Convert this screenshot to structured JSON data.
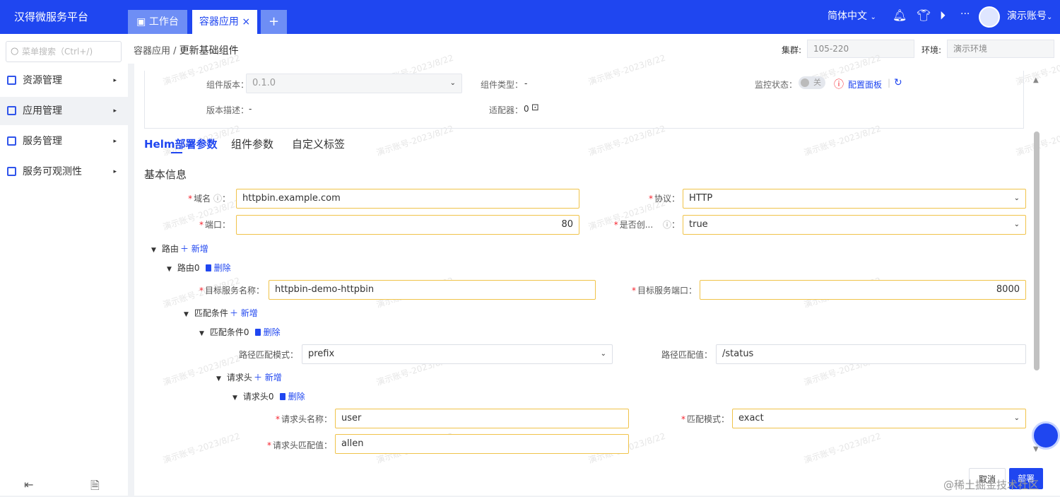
{
  "header": {
    "brand": "汉得微服务平台",
    "tabs": [
      {
        "label": "工作台",
        "icon": "monitor-icon"
      },
      {
        "label": "容器应用",
        "close": "×"
      },
      {
        "label": "+"
      }
    ],
    "language": "简体中文",
    "more": "···",
    "user": "演示账号"
  },
  "sidebar": {
    "search_placeholder": "菜单搜索（Ctrl+/)",
    "items": [
      {
        "label": "资源管理",
        "icon": "cube-icon"
      },
      {
        "label": "应用管理",
        "icon": "cube-icon",
        "active": true
      },
      {
        "label": "服务管理",
        "icon": "service-icon"
      },
      {
        "label": "服务可观测性",
        "icon": "service-icon"
      }
    ]
  },
  "breadcrumb": {
    "parent": "容器应用",
    "sep": "/",
    "current": "更新基础组件",
    "cluster_label": "集群:",
    "cluster_value": "105-220",
    "env_label": "环境:",
    "env_value": "演示环境"
  },
  "info": {
    "version_label": "组件版本：",
    "version_value": "0.1.0",
    "type_label": "组件类型：",
    "type_value": "-",
    "monitor_label": "监控状态：",
    "monitor_toggle": "关",
    "config_panel": "配置面板",
    "desc_label": "版本描述：",
    "desc_value": "-",
    "adapter_label": "适配器：",
    "adapter_value": "0"
  },
  "tabs": [
    "Helm部署参数",
    "组件参数",
    "自定义标签"
  ],
  "section_title": "基本信息",
  "form": {
    "domain_label": "域名",
    "domain_value": "httpbin.example.com",
    "protocol_label": "协议：",
    "protocol_value": "HTTP",
    "port_label": "端口：",
    "port_value": "80",
    "create_label": "是否创...",
    "create_value": "true",
    "routes_label": "路由",
    "add_label": "新增",
    "delete_label": "删除",
    "route0_label": "路由0",
    "target_name_label": "目标服务名称：",
    "target_name_value": "httpbin-demo-httpbin",
    "target_port_label": "目标服务端口：",
    "target_port_value": "8000",
    "match_label": "匹配条件",
    "match0_label": "匹配条件0",
    "path_mode_label": "路径匹配模式：",
    "path_mode_value": "prefix",
    "path_value_label": "路径匹配值：",
    "path_value": "/status",
    "headers_label": "请求头",
    "header0_label": "请求头0",
    "header_name_label": "请求头名称：",
    "header_name_value": "user",
    "match_mode_label": "匹配模式：",
    "match_mode_value": "exact",
    "header_value_label": "请求头匹配值：",
    "header_value": "allen"
  },
  "buttons": {
    "cancel": "取消",
    "deploy": "部署"
  },
  "watermark": "演示账号-2023/8/22",
  "footer_watermark": "@稀土掘金技术社区"
}
